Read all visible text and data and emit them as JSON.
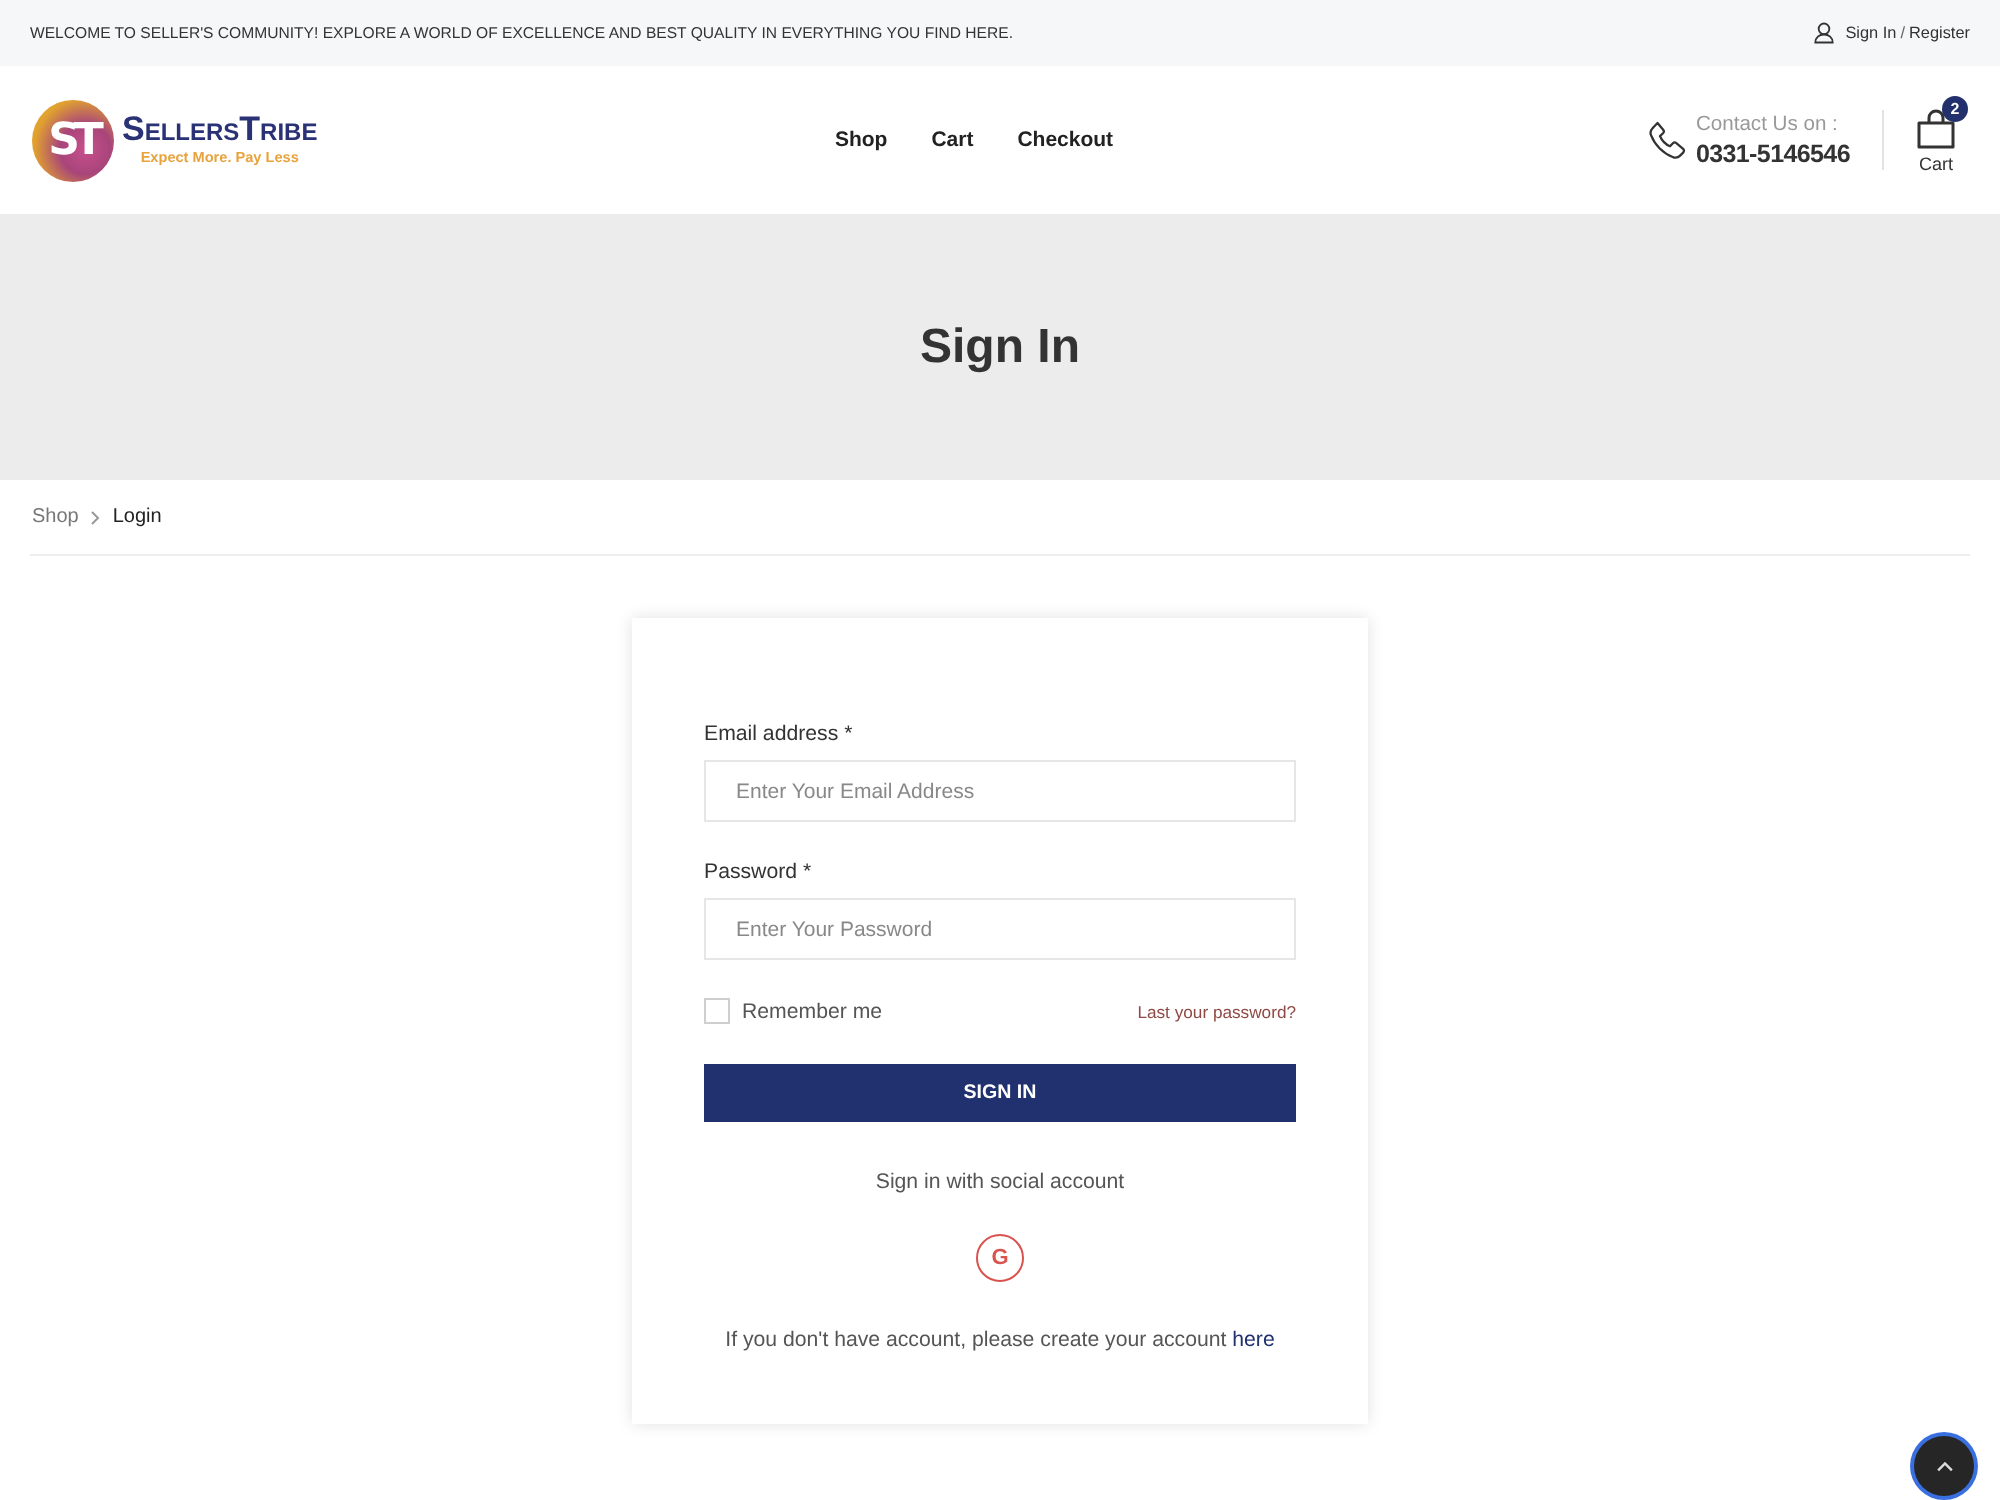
{
  "top_bar": {
    "message": "WELCOME TO SELLER'S COMMUNITY! EXPLORE A WORLD OF EXCELLENCE AND BEST QUALITY IN EVERYTHING YOU FIND HERE.",
    "account_links": [
      {
        "label": "Sign In"
      },
      {
        "label": "Register"
      }
    ],
    "separator": "/"
  },
  "header": {
    "logo": {
      "mark": "ST",
      "name": "SellersTribe",
      "tagline": "Expect More. Pay Less"
    },
    "nav": [
      {
        "label": "Shop"
      },
      {
        "label": "Cart"
      },
      {
        "label": "Checkout"
      }
    ],
    "contact": {
      "label": "Contact Us on :",
      "phone": "0331-5146546"
    },
    "cart": {
      "count": "2",
      "label": "Cart"
    }
  },
  "page_title": "Sign In",
  "breadcrumb": [
    {
      "label": "Shop",
      "current": false
    },
    {
      "label": "Login",
      "current": true
    }
  ],
  "login_form": {
    "fields": [
      {
        "label": "Email address *",
        "placeholder": "Enter Your Email Address"
      },
      {
        "label": "Password *",
        "placeholder": "Enter Your Password"
      }
    ],
    "remember": {
      "label": "Remember me",
      "checked": false
    },
    "forgot_link": "Last your password?",
    "submit": "SIGN IN",
    "social_heading": "Sign in with social account",
    "social_buttons": [
      {
        "kind": "google",
        "label": "G"
      }
    ],
    "register_prompt": "If you don't have account, please create your account",
    "register_link": "here"
  }
}
